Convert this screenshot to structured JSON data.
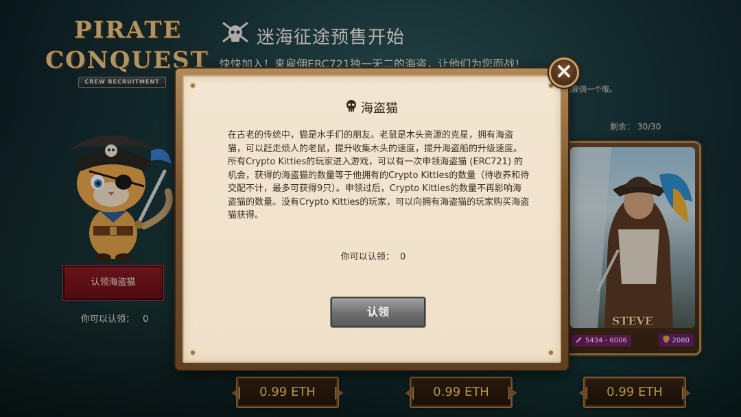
{
  "logo": {
    "line1": "PIRATE",
    "line2": "CONQUEST",
    "ribbon": "CREW RECRUITMENT"
  },
  "header": {
    "title": "迷海征途预售开始",
    "subtitle": "快快加入！来雇佣ERC721独一无二的海盗，让他们为您而战！"
  },
  "background": {
    "note": "能雇佣一个哦。",
    "remaining": "剩余：  30/30"
  },
  "left_panel": {
    "claim_button": "认领海盗猫",
    "claimable_label": "你可以认领：",
    "claimable_value": "0"
  },
  "card": {
    "name": "STEVE",
    "range": "5434 - 6006",
    "power": "2080"
  },
  "prices": [
    "0.99 ETH",
    "0.99 ETH",
    "0.99 ETH"
  ],
  "modal": {
    "title": "海盗猫",
    "body": "在古老的传统中，猫是水手们的朋友。老鼠是木头资源的克星，拥有海盗猫，可以赶走烦人的老鼠，提升收集木头的速度，提升海盗船的升级速度。所有Crypto Kitties的玩家进入游戏，可以有一次申领海盗猫 (ERC721) 的机会，获得的海盗猫的数量等于他拥有的Crypto Kitties的数量（待收养和待交配不计，最多可获得9只）。申领过后，Crypto Kitties的数量不再影响海盗猫的数量。没有Crypto Kitties的玩家，可以向拥有海盗猫的玩家购买海盗猫获得。",
    "claimable_label": "你可以认领：",
    "claimable_value": "0",
    "claim_button": "认领"
  },
  "colors": {
    "modal_bg": "#f0e2ca",
    "frame": "#8a6234",
    "red_button": "#7a141c",
    "gold_text": "#f0c868"
  }
}
